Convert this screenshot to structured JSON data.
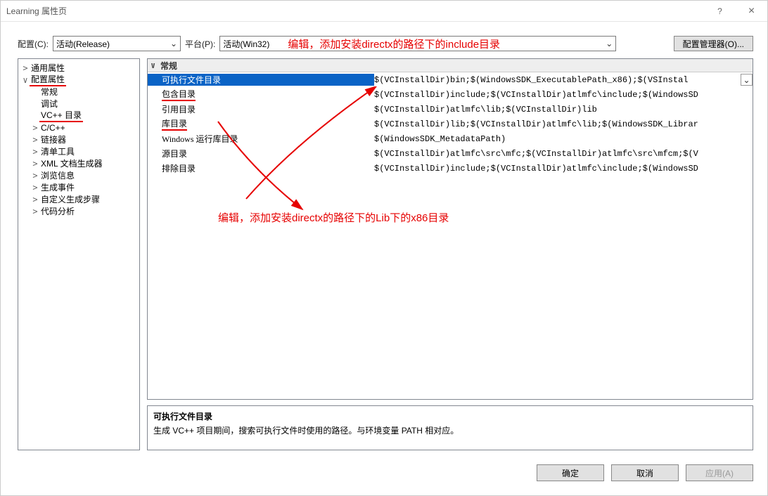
{
  "title": "Learning 属性页",
  "titlebar": {
    "help": "?",
    "close": "×"
  },
  "toolbar": {
    "config_label": "配置(C):",
    "config_value": "活动(Release)",
    "platform_label": "平台(P):",
    "platform_value": "活动(Win32)",
    "platform_overlay_annotation": "编辑，添加安装directx的路径下的include目录",
    "config_manager": "配置管理器(O)..."
  },
  "tree": {
    "common": "通用属性",
    "config_props": "配置属性",
    "general": "常规",
    "debug": "调试",
    "vc_dirs": "VC++ 目录",
    "ccpp": "C/C++",
    "linker": "链接器",
    "manifest": "清单工具",
    "xml_doc": "XML 文档生成器",
    "browse": "浏览信息",
    "build_events": "生成事件",
    "custom_build": "自定义生成步骤",
    "code_analysis": "代码分析"
  },
  "grid": {
    "group": "常规",
    "rows": [
      {
        "name": "可执行文件目录",
        "value": "$(VCInstallDir)bin;$(WindowsSDK_ExecutablePath_x86);$(VSInstal"
      },
      {
        "name": "包含目录",
        "value": "$(VCInstallDir)include;$(VCInstallDir)atlmfc\\include;$(WindowsSD"
      },
      {
        "name": "引用目录",
        "value": "$(VCInstallDir)atlmfc\\lib;$(VCInstallDir)lib"
      },
      {
        "name": "库目录",
        "value": "$(VCInstallDir)lib;$(VCInstallDir)atlmfc\\lib;$(WindowsSDK_Librar"
      },
      {
        "name": "Windows 运行库目录",
        "value": "$(WindowsSDK_MetadataPath)"
      },
      {
        "name": "源目录",
        "value": "$(VCInstallDir)atlmfc\\src\\mfc;$(VCInstallDir)atlmfc\\src\\mfcm;$(V"
      },
      {
        "name": "排除目录",
        "value": "$(VCInstallDir)include;$(VCInstallDir)atlmfc\\include;$(WindowsSD"
      }
    ]
  },
  "desc": {
    "heading": "可执行文件目录",
    "text": "生成 VC++ 项目期间，搜索可执行文件时使用的路径。与环境变量 PATH 相对应。"
  },
  "buttons": {
    "ok": "确定",
    "cancel": "取消",
    "apply": "应用(A)"
  },
  "annotations": {
    "lib": "编辑，添加安装directx的路径下的Lib下的x86目录"
  }
}
